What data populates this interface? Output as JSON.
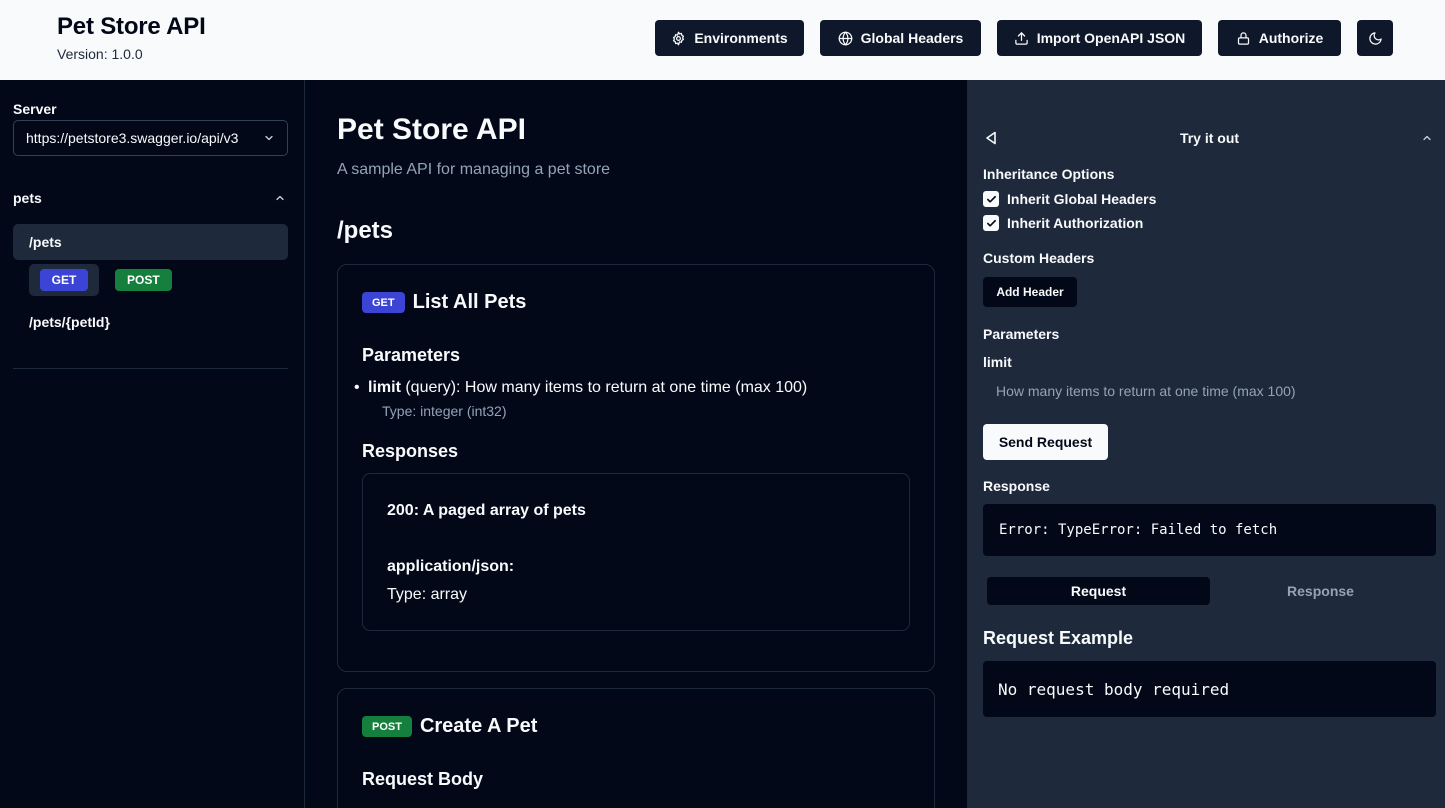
{
  "header": {
    "title": "Pet Store API",
    "version": "Version: 1.0.0",
    "buttons": {
      "environments": "Environments",
      "global_headers": "Global Headers",
      "import": "Import OpenAPI JSON",
      "authorize": "Authorize"
    }
  },
  "sidebar": {
    "server_label": "Server",
    "server_value": "https://petstore3.swagger.io/api/v3",
    "group": "pets",
    "paths": [
      "/pets",
      "/pets/{petId}"
    ],
    "methods": [
      "GET",
      "POST"
    ]
  },
  "main": {
    "title": "Pet Store API",
    "description": "A sample API for managing a pet store",
    "path_heading": "/pets",
    "get_card": {
      "method": "GET",
      "title": "List All Pets",
      "parameters_title": "Parameters",
      "param_name": "limit",
      "param_desc": " (query): How many items to return at one time (max 100)",
      "param_type": "Type: integer (int32)",
      "responses_title": "Responses",
      "response_code": "200: A paged array of pets",
      "content_type": "application/json:",
      "response_type": "Type: array"
    },
    "post_card": {
      "method": "POST",
      "title": "Create A Pet",
      "request_body_title": "Request Body"
    }
  },
  "panel": {
    "title": "Try it out",
    "inheritance_title": "Inheritance Options",
    "inherit_headers": "Inherit Global Headers",
    "inherit_auth": "Inherit Authorization",
    "custom_headers_title": "Custom Headers",
    "add_header": "Add Header",
    "parameters_title": "Parameters",
    "limit_label": "limit",
    "limit_placeholder": "How many items to return at one time (max 100)",
    "send_request": "Send Request",
    "response_title": "Response",
    "response_error": "Error: TypeError: Failed to fetch",
    "tabs": [
      "Request",
      "Response"
    ],
    "request_example_title": "Request Example",
    "request_example_body": "No request body required"
  },
  "colors": {
    "get_badge": "#3b44d4",
    "post_badge": "#15803d",
    "background": "#020817",
    "panel": "#1e293b"
  }
}
